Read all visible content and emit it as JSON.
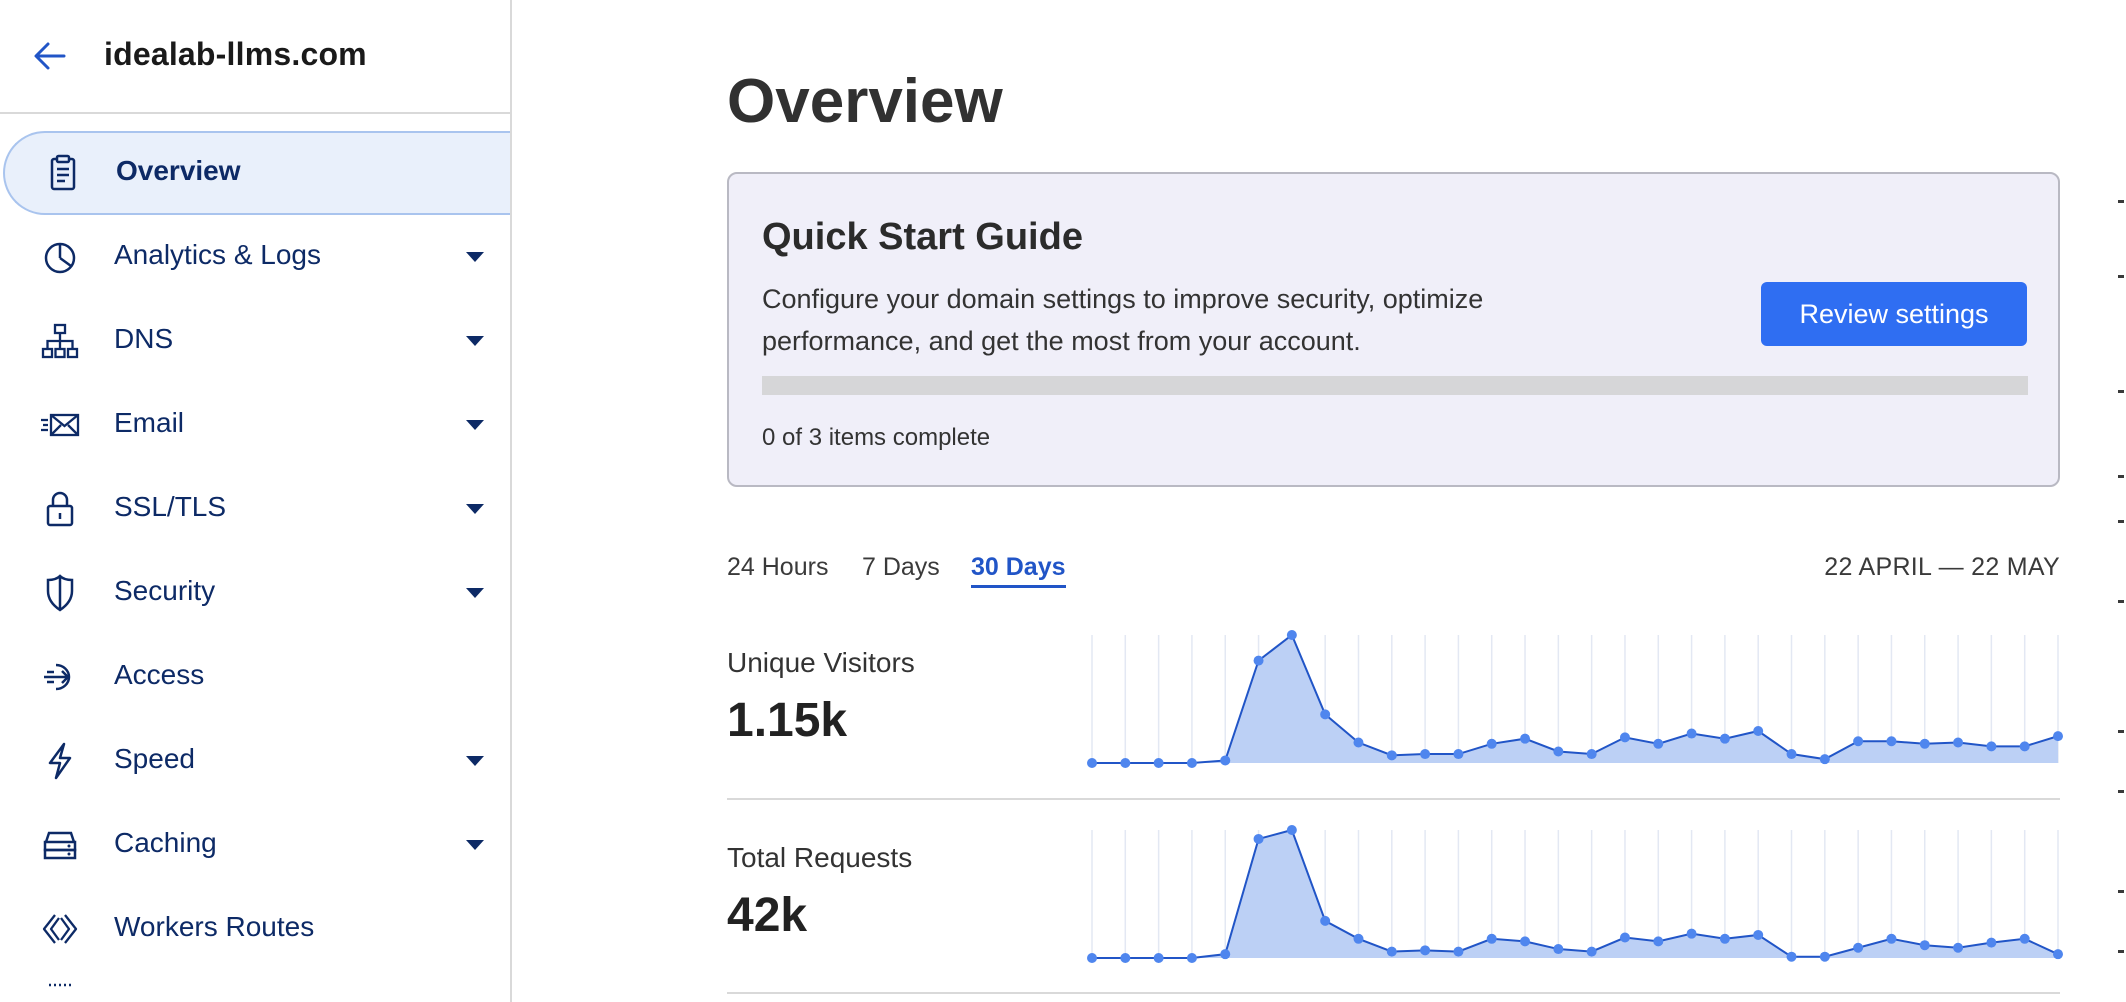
{
  "sidebar": {
    "domain": "idealab-llms.com",
    "back_icon": "arrow-left-icon",
    "items": [
      {
        "label": "Overview",
        "icon": "clipboard-icon",
        "active": true,
        "has_caret": false
      },
      {
        "label": "Analytics & Logs",
        "icon": "pie-chart-icon",
        "active": false,
        "has_caret": true
      },
      {
        "label": "DNS",
        "icon": "network-tree-icon",
        "active": false,
        "has_caret": true
      },
      {
        "label": "Email",
        "icon": "email-fast-icon",
        "active": false,
        "has_caret": true
      },
      {
        "label": "SSL/TLS",
        "icon": "lock-icon",
        "active": false,
        "has_caret": true
      },
      {
        "label": "Security",
        "icon": "shield-icon",
        "active": false,
        "has_caret": true
      },
      {
        "label": "Access",
        "icon": "access-arrow-icon",
        "active": false,
        "has_caret": false
      },
      {
        "label": "Speed",
        "icon": "lightning-icon",
        "active": false,
        "has_caret": true
      },
      {
        "label": "Caching",
        "icon": "storage-drive-icon",
        "active": false,
        "has_caret": true
      },
      {
        "label": "Workers Routes",
        "icon": "code-brackets-icon",
        "active": false,
        "has_caret": false
      }
    ]
  },
  "main": {
    "title": "Overview",
    "quick_start": {
      "title": "Quick Start Guide",
      "description": "Configure your domain settings to improve security, optimize performance, and get the most from your account.",
      "button_label": "Review settings",
      "progress_fraction": 0,
      "status": "0 of 3 items complete"
    },
    "time_tabs": [
      {
        "label": "24 Hours",
        "active": false
      },
      {
        "label": "7 Days",
        "active": false
      },
      {
        "label": "30 Days",
        "active": true
      }
    ],
    "date_range": "22 APRIL — 22 MAY",
    "metrics": [
      {
        "label": "Unique Visitors",
        "value": "1.15k"
      },
      {
        "label": "Total Requests",
        "value": "42k"
      }
    ]
  },
  "colors": {
    "accent": "#2f6ef2",
    "nav_text": "#0d2a66",
    "nav_active_bg": "#e9f0fb",
    "chart_line": "#2155c7",
    "chart_fill": "#bcd0f5",
    "chart_point": "#4f86ee"
  },
  "chart_data": [
    {
      "type": "area",
      "title": "Unique Visitors",
      "x": [
        1,
        2,
        3,
        4,
        5,
        6,
        7,
        8,
        9,
        10,
        11,
        12,
        13,
        14,
        15,
        16,
        17,
        18,
        19,
        20,
        21,
        22,
        23,
        24,
        25,
        26,
        27,
        28,
        29,
        30
      ],
      "values": [
        0,
        0,
        0,
        0,
        2,
        80,
        100,
        38,
        16,
        6,
        7,
        7,
        15,
        19,
        9,
        7,
        20,
        15,
        23,
        19,
        25,
        7,
        3,
        17,
        17,
        15,
        16,
        13,
        13,
        21
      ],
      "ylim": [
        0,
        100
      ],
      "grid": "vertical"
    },
    {
      "type": "area",
      "title": "Total Requests",
      "x": [
        1,
        2,
        3,
        4,
        5,
        6,
        7,
        8,
        9,
        10,
        11,
        12,
        13,
        14,
        15,
        16,
        17,
        18,
        19,
        20,
        21,
        22,
        23,
        24,
        25,
        26,
        27,
        28,
        29,
        30
      ],
      "values": [
        0,
        0,
        0,
        0,
        3,
        93,
        100,
        29,
        15,
        5,
        6,
        5,
        15,
        13,
        7,
        5,
        16,
        13,
        19,
        15,
        18,
        1,
        1,
        8,
        15,
        10,
        8,
        12,
        15,
        3
      ],
      "ylim": [
        0,
        100
      ],
      "grid": "vertical"
    }
  ]
}
